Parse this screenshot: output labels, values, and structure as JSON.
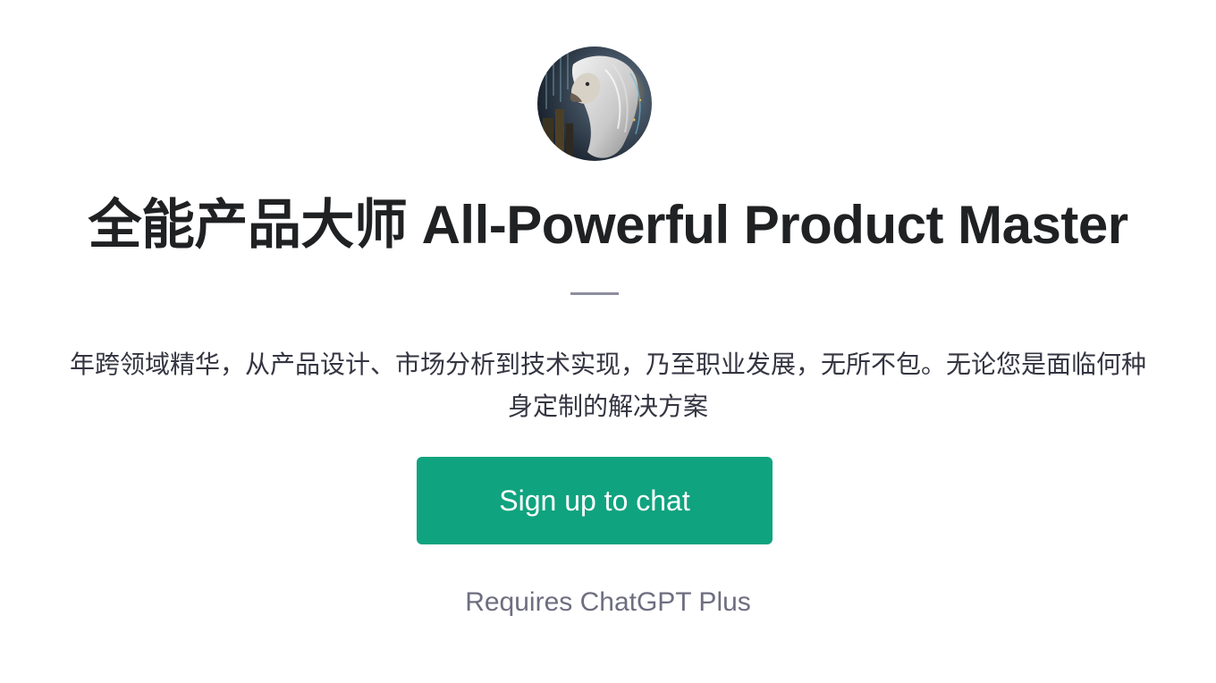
{
  "gpt": {
    "avatar_icon": "lion-portrait-icon",
    "title": "全能产品大师 All-Powerful Product Master",
    "description_line1": "年跨领域精华，从产品设计、市场分析到技术实现，乃至职业发展，无所不包。无论您是面临何种",
    "description_line2": "身定制的解决方案"
  },
  "cta": {
    "label": "Sign up to chat",
    "color": "#10a37f"
  },
  "note": {
    "text": "Requires ChatGPT Plus"
  }
}
